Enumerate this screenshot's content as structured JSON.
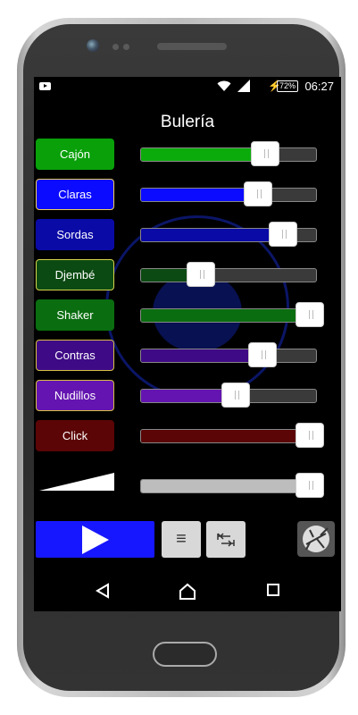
{
  "status": {
    "battery": "72%",
    "time": "06:27"
  },
  "title": "Bulería",
  "tracks": [
    {
      "label": "Cajón",
      "level": 0.7,
      "pad_bg": "#09a00a",
      "pad_border": "#09a00a",
      "fill": "#0cab0c"
    },
    {
      "label": "Claras",
      "level": 0.65,
      "pad_bg": "#0b0bff",
      "pad_border": "#f0d060",
      "fill": "#0b0bff"
    },
    {
      "label": "Sordas",
      "level": 0.82,
      "pad_bg": "#0a0aa6",
      "pad_border": "#0a0aa6",
      "fill": "#0a0aa6"
    },
    {
      "label": "Djembé",
      "level": 0.27,
      "pad_bg": "#0b4a12",
      "pad_border": "#d8d34a",
      "fill": "#0b4a12"
    },
    {
      "label": "Shaker",
      "level": 1.0,
      "pad_bg": "#0a6d10",
      "pad_border": "#0a6d10",
      "fill": "#0a6d10"
    },
    {
      "label": "Contras",
      "level": 0.68,
      "pad_bg": "#3e0a86",
      "pad_border": "#d8c045",
      "fill": "#3e0a86"
    },
    {
      "label": "Nudillos",
      "level": 0.5,
      "pad_bg": "#6414b0",
      "pad_border": "#d8c045",
      "fill": "#6414b0"
    },
    {
      "label": "Click",
      "level": 1.0,
      "pad_bg": "#5b0507",
      "pad_border": "#5b0507",
      "fill": "#5b0507"
    }
  ],
  "master_volume": {
    "level": 1.0,
    "fill": "#bdbdbd"
  },
  "controls": {
    "play": "play-icon",
    "menu": "menu-icon",
    "loop": "tab-arrows-icon",
    "logo": "cricket-logo-icon"
  }
}
